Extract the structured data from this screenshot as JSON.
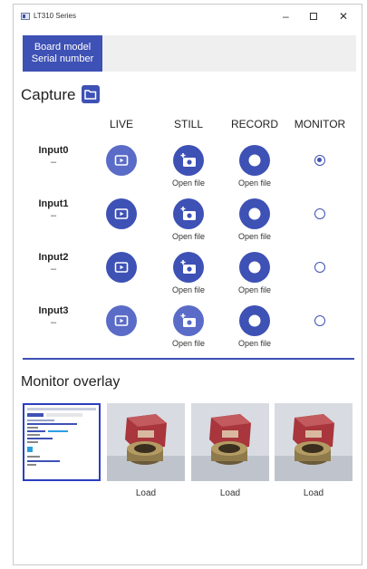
{
  "window": {
    "title": "LT310 Series",
    "min": "–",
    "close": "✕"
  },
  "board": {
    "line1": "Board model",
    "line2": "Serial number"
  },
  "capture": {
    "title": "Capture",
    "columns": [
      "LIVE",
      "STILL",
      "RECORD",
      "MONITOR"
    ],
    "open_file": "Open file",
    "inputs": [
      {
        "name": "Input0",
        "sub": "–",
        "monitor_selected": true
      },
      {
        "name": "Input1",
        "sub": "–",
        "monitor_selected": false
      },
      {
        "name": "Input2",
        "sub": "–",
        "monitor_selected": false
      },
      {
        "name": "Input3",
        "sub": "–",
        "monitor_selected": false
      }
    ]
  },
  "overlay": {
    "title": "Monitor overlay",
    "load_label": "Load",
    "thumbnails": [
      "screen-capture",
      "photo",
      "photo",
      "photo"
    ]
  },
  "colors": {
    "accent": "#3e51b5",
    "live": "#5a6cc7"
  },
  "icons": {
    "live": "live-view-icon",
    "still": "camera-add-icon",
    "record": "record-icon",
    "folder": "folder-icon"
  }
}
